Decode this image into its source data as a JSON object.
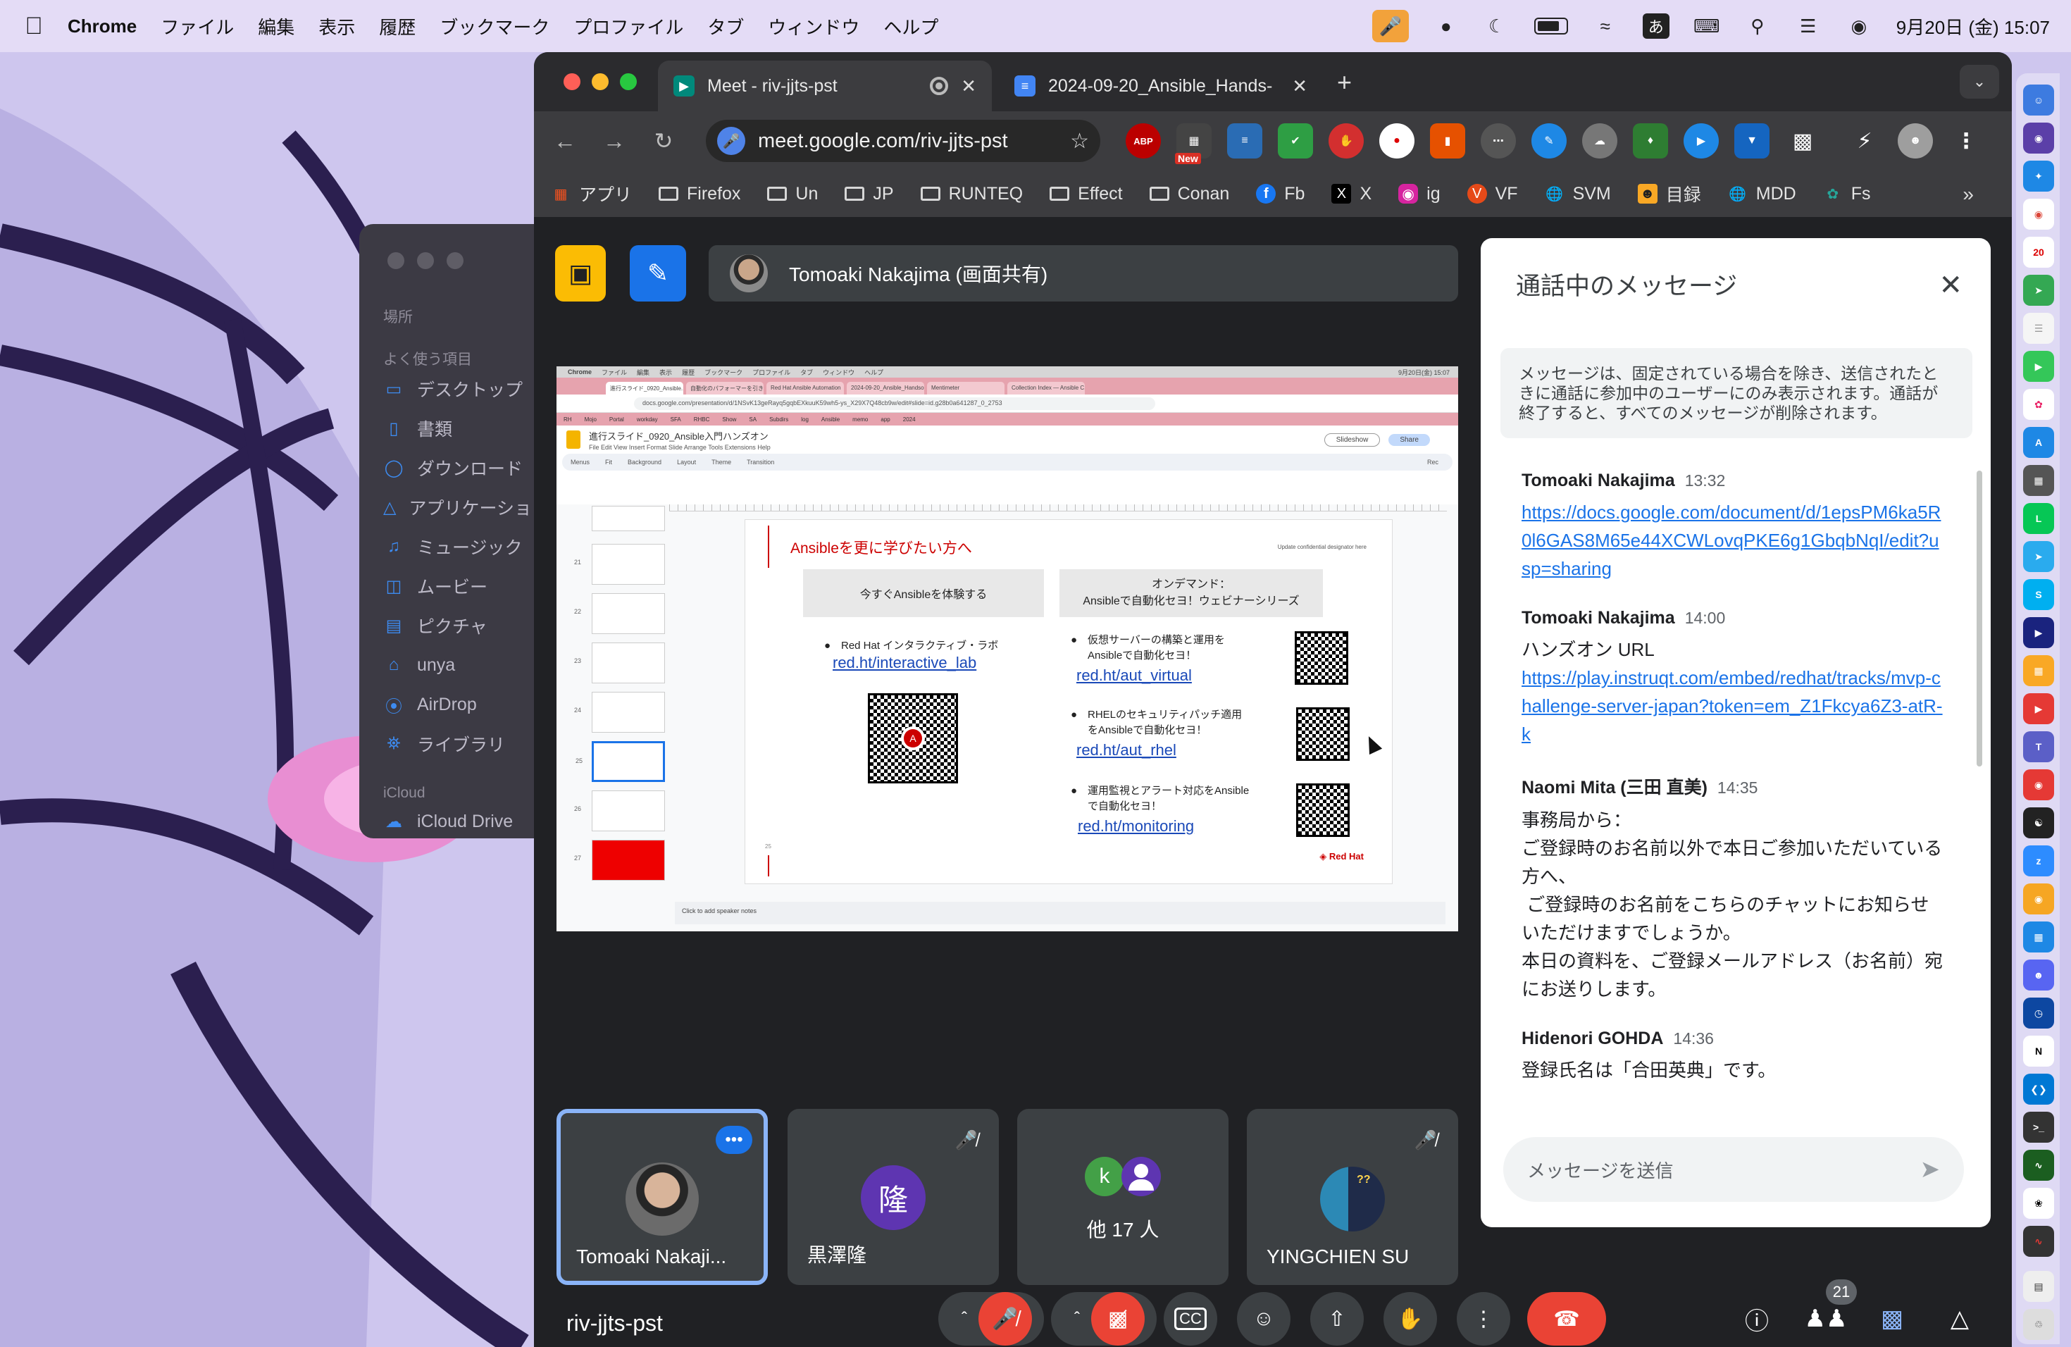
{
  "menubar": {
    "app": "Chrome",
    "items": [
      "ファイル",
      "編集",
      "表示",
      "履歴",
      "ブックマーク",
      "プロファイル",
      "タブ",
      "ウィンドウ",
      "ヘルプ"
    ],
    "ime": "あ",
    "datetime": "9月20日 (金) 15:07"
  },
  "finder": {
    "section_places": "場所",
    "section_favorites": "よく使う項目",
    "items": [
      "デスクトップ",
      "書類",
      "ダウンロード",
      "アプリケーション",
      "ミュージック",
      "ムービー",
      "ピクチャ",
      "unya",
      "AirDrop",
      "ライブラリ"
    ],
    "section_icloud": "iCloud",
    "icloud_drive": "iCloud Drive"
  },
  "chrome": {
    "tabs": [
      {
        "title": "Meet - riv-jjts-pst",
        "active": true
      },
      {
        "title": "2024-09-20_Ansible_Hands-",
        "active": false
      }
    ],
    "url": "meet.google.com/riv-jjts-pst",
    "ext_new": "New",
    "bookmarks": [
      "アプリ",
      "Firefox",
      "Un",
      "JP",
      "RUNTEQ",
      "Effect",
      "Conan",
      "Fb",
      "X",
      "ig",
      "VF",
      "SVM",
      "目録",
      "MDD",
      "Fs"
    ]
  },
  "meet": {
    "presenter": "Tomoaki Nakajima (画面共有)",
    "meeting_code": "riv-jjts-pst",
    "participants_count": "21",
    "tiles": [
      {
        "name": "Tomoaki Nakaji...",
        "active": true
      },
      {
        "name": "黒澤隆",
        "avatar": "隆"
      },
      {
        "name": "他 17 人",
        "avatar": "k"
      },
      {
        "name": "YINGCHIEN SU",
        "avatar": "??"
      }
    ]
  },
  "shared": {
    "menubar": [
      "Chrome",
      "ファイル",
      "編集",
      "表示",
      "履歴",
      "ブックマーク",
      "プロファイル",
      "タブ",
      "ウィンドウ",
      "ヘルプ"
    ],
    "datetime": "9月20日(金) 15:07",
    "tabs": [
      "進行スライド_0920_Ansible...",
      "自動化のパフォーマーを引き上...",
      "Red Hat Ansible Automation",
      "2024-09-20_Ansible_Handso...",
      "Mentimeter",
      "Collection Index — Ansible C..."
    ],
    "url": "docs.google.com/presentation/d/1NSvK13geRayq5gqbEXkuuK59wh5-ys_X29X7Q48cb9w/edit#slide=id.g28b0a641287_0_2753",
    "bookmarks": [
      "RH",
      "Mojo",
      "Portal",
      "workday",
      "SFA",
      "RHBC",
      "Show",
      "SA",
      "Subdirs",
      "log",
      "Ansible",
      "memo",
      "app",
      "2024"
    ],
    "doc_title": "進行スライド_0920_Ansible入門ハンズオン",
    "doc_menu": "File  Edit  View  Insert  Format  Slide  Arrange  Tools  Extensions  Help",
    "slideshow": "Slideshow",
    "share": "Share",
    "toolbar": [
      "Menus",
      "Fit",
      "Background",
      "Layout",
      "Theme",
      "Transition",
      "Rec"
    ],
    "thumb_numbers": [
      "21",
      "22",
      "23",
      "24",
      "25",
      "26",
      "27"
    ],
    "slide": {
      "title": "Ansibleを更に学びたい方へ",
      "confidential": "Update confidential designator here",
      "box1": "今すぐAnsibleを体験する",
      "box2_line1": "オンデマンド：",
      "box2_line2": "Ansibleで自動化セヨ！ウェビナーシリーズ",
      "item1": "Red Hat インタラクティブ・ラボ",
      "link1": "red.ht/interactive_lab",
      "item2_l1": "仮想サーバーの構築と運用を",
      "item2_l2": "Ansibleで自動化セヨ！",
      "link2": "red.ht/aut_virtual",
      "item3_l1": "RHELのセキュリティパッチ適用",
      "item3_l2": "をAnsibleで自動化セヨ！",
      "link3": "red.ht/aut_rhel",
      "item4_l1": "運用監視とアラート対応をAnsible",
      "item4_l2": "で自動化セヨ！",
      "link4": "red.ht/monitoring",
      "brand": "Red Hat",
      "page_num": "25"
    },
    "notes": "Click to add speaker notes"
  },
  "chat": {
    "title": "通話中のメッセージ",
    "notice": "メッセージは、固定されている場合を除き、送信されたときに通話に参加中のユーザーにのみ表示されます。通話が終了すると、すべてのメッセージが削除されます。",
    "messages": [
      {
        "sender": "Tomoaki Nakajima",
        "time": "13:32",
        "link": "https://docs.google.com/document/d/1epsPM6ka5R0l6GAS8M65e44XCWLovqPKE6g1GbqbNqI/edit?usp=sharing"
      },
      {
        "sender": "Tomoaki Nakajima",
        "time": "14:00",
        "text": "ハンズオン URL",
        "link": "https://play.instruqt.com/embed/redhat/tracks/mvp-challenge-server-japan?token=em_Z1Fkcya6Z3-atR-k"
      },
      {
        "sender": "Naomi Mita (三田 直美)",
        "time": "14:35",
        "lines": [
          "事務局から：",
          "ご登録時のお名前以外で本日ご参加いただいている方へ、",
          " ご登録時のお名前をこちらのチャットにお知らせいただけますでしょうか。",
          "本日の資料を、ご登録メールアドレス（お名前）宛にお送りします。"
        ]
      },
      {
        "sender": "Hidenori GOHDA",
        "time": "14:36",
        "text": "登録氏名は「合田英典」です。"
      }
    ],
    "input_placeholder": "メッセージを送信"
  },
  "dock": {
    "calendar_day": "20"
  },
  "colors": {
    "accent": "#1a73e8",
    "end_call": "#ea4335",
    "meet_bg": "#202124",
    "tile_bg": "#3c4043",
    "redhat": "#cc0000"
  }
}
